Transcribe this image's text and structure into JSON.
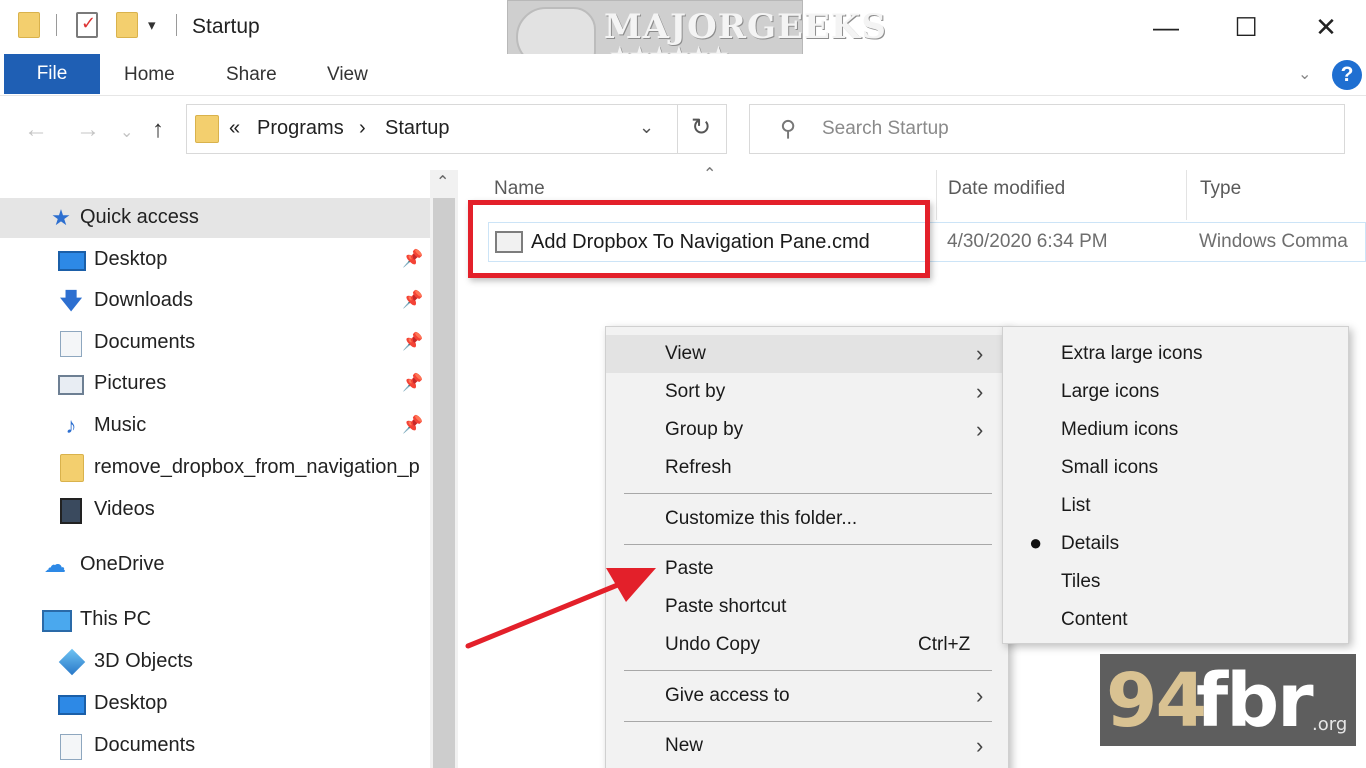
{
  "window": {
    "title": "Startup",
    "quick_access_dropdown": "▾",
    "minimize": "—",
    "maximize": "☐",
    "close": "✕"
  },
  "watermark_logo": {
    "text": "MAJORGEEKS",
    "sub": "★★★★★★ .COM"
  },
  "ribbon": {
    "tabs": [
      "File",
      "Home",
      "Share",
      "View"
    ],
    "expand_chevron": "⌄",
    "help": "?"
  },
  "navigation": {
    "back": "←",
    "forward": "→",
    "recent": "⌄",
    "up": "↑"
  },
  "address": {
    "overflow": "«",
    "crumbs": [
      "Programs",
      "Startup"
    ],
    "separator": "›",
    "dropdown": "⌄",
    "refresh": "↻"
  },
  "search": {
    "placeholder": "Search Startup",
    "icon_glyph": "⚲"
  },
  "nav_pane": {
    "scroll_up": "⌃",
    "pin_glyph": "📌",
    "items": [
      {
        "label": "Quick access",
        "icon": "star-icon",
        "glyph": "★",
        "pinned": false,
        "level": 0
      },
      {
        "label": "Desktop",
        "icon": "desktop-icon",
        "glyph": "",
        "pinned": true,
        "level": 1
      },
      {
        "label": "Downloads",
        "icon": "download-icon",
        "glyph": "🡇",
        "pinned": true,
        "level": 1
      },
      {
        "label": "Documents",
        "icon": "documents-icon",
        "glyph": "",
        "pinned": true,
        "level": 1
      },
      {
        "label": "Pictures",
        "icon": "pictures-icon",
        "glyph": "",
        "pinned": true,
        "level": 1
      },
      {
        "label": "Music",
        "icon": "music-icon",
        "glyph": "♪",
        "pinned": true,
        "level": 1
      },
      {
        "label": "remove_dropbox_from_navigation_p",
        "icon": "folder-icon",
        "glyph": "",
        "pinned": false,
        "level": 1
      },
      {
        "label": "Videos",
        "icon": "videos-icon",
        "glyph": "",
        "pinned": false,
        "level": 1
      },
      {
        "label": "OneDrive",
        "icon": "cloud-icon",
        "glyph": "☁",
        "pinned": false,
        "level": 0
      },
      {
        "label": "This PC",
        "icon": "computer-icon",
        "glyph": "",
        "pinned": false,
        "level": 0
      },
      {
        "label": "3D Objects",
        "icon": "cube-icon",
        "glyph": "",
        "pinned": false,
        "level": 1
      },
      {
        "label": "Desktop",
        "icon": "desktop-icon",
        "glyph": "",
        "pinned": false,
        "level": 1
      },
      {
        "label": "Documents",
        "icon": "documents-icon",
        "glyph": "",
        "pinned": false,
        "level": 1
      }
    ]
  },
  "file_list": {
    "columns": [
      "Name",
      "Date modified",
      "Type"
    ],
    "sort_caret": "⌃",
    "rows": [
      {
        "name": "Add Dropbox To Navigation Pane.cmd",
        "date": "4/30/2020 6:34 PM",
        "type": "Windows Comma"
      }
    ]
  },
  "context_menu": {
    "items": [
      {
        "label": "View",
        "submenu": true,
        "shortcut": ""
      },
      {
        "label": "Sort by",
        "submenu": true,
        "shortcut": ""
      },
      {
        "label": "Group by",
        "submenu": true,
        "shortcut": ""
      },
      {
        "label": "Refresh",
        "submenu": false,
        "shortcut": ""
      },
      {
        "label": "Customize this folder...",
        "submenu": false,
        "shortcut": ""
      },
      {
        "label": "Paste",
        "submenu": false,
        "shortcut": ""
      },
      {
        "label": "Paste shortcut",
        "submenu": false,
        "shortcut": ""
      },
      {
        "label": "Undo Copy",
        "submenu": false,
        "shortcut": "Ctrl+Z"
      },
      {
        "label": "Give access to",
        "submenu": true,
        "shortcut": ""
      },
      {
        "label": "New",
        "submenu": true,
        "shortcut": ""
      }
    ],
    "submenu_arrow": "›"
  },
  "view_submenu": {
    "items": [
      "Extra large icons",
      "Large icons",
      "Medium icons",
      "Small icons",
      "List",
      "Details",
      "Tiles",
      "Content"
    ],
    "selected": "Details",
    "bullet": "●"
  },
  "watermark_site": {
    "num": "94",
    "name": "fbr",
    "tld": ".org"
  },
  "colors": {
    "file_tab": "#1f5fb4",
    "highlight_box": "#e3202a",
    "annotation_arrow": "#e3202a",
    "help_icon": "#1f6fd1"
  }
}
